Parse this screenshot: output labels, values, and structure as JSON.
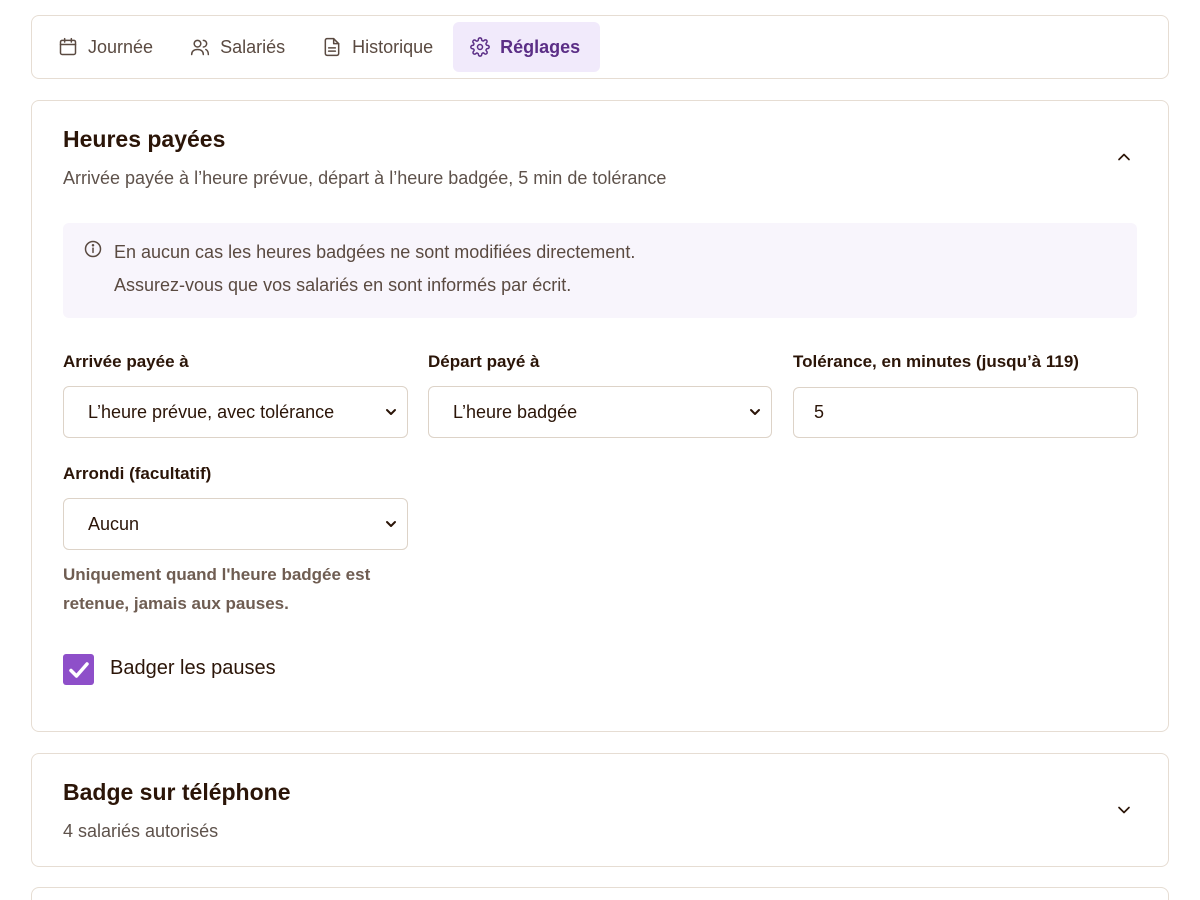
{
  "tabs": [
    {
      "label": "Journée",
      "icon": "calendar-icon"
    },
    {
      "label": "Salariés",
      "icon": "users-icon"
    },
    {
      "label": "Historique",
      "icon": "document-icon"
    },
    {
      "label": "Réglages",
      "icon": "gear-icon",
      "active": true
    }
  ],
  "paid_hours": {
    "title": "Heures payées",
    "subtitle": "Arrivée payée à l’heure prévue, départ à l’heure badgée, 5 min de tolérance",
    "expanded": true,
    "info_line1": "En aucun cas les heures badgées ne sont modifiées directement.",
    "info_line2": "Assurez-vous que vos salariés en sont informés par écrit.",
    "arrival_label": "Arrivée payée à",
    "arrival_value": "L’heure prévue, avec tolérance",
    "departure_label": "Départ payé à",
    "departure_value": "L’heure badgée",
    "tolerance_label": "Tolérance, en minutes (jusqu’à 119)",
    "tolerance_value": "5",
    "rounding_label": "Arrondi (facultatif)",
    "rounding_value": "Aucun",
    "rounding_hint_1": "Uniquement quand l'heure badgée est",
    "rounding_hint_2": "retenue, jamais aux pauses.",
    "breaks_label": "Badger les pauses",
    "breaks_checked": true
  },
  "phone_badge": {
    "title": "Badge sur téléphone",
    "subtitle": "4 salariés autorisés",
    "expanded": false
  },
  "colors": {
    "accent": "#8e4fc9",
    "active_tab_bg": "#f1eafb",
    "active_tab_text": "#5b2e86",
    "info_bg": "#f8f5fc"
  }
}
